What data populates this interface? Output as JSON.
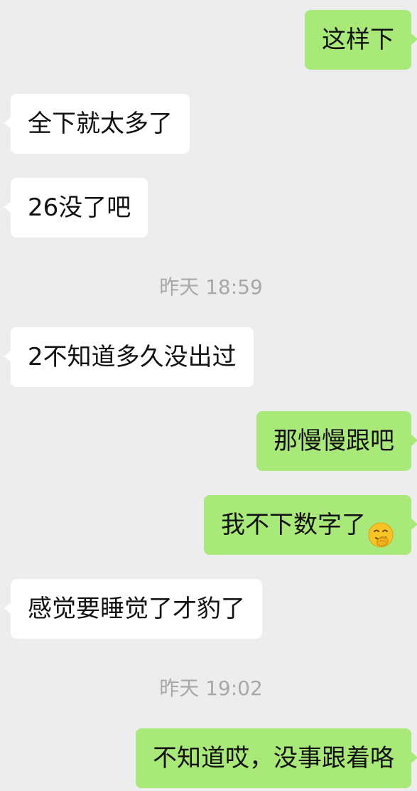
{
  "messages": [
    {
      "side": "out",
      "text": "这样下"
    },
    {
      "side": "in",
      "text": "全下就太多了"
    },
    {
      "side": "in",
      "text": "26没了吧"
    },
    {
      "side": "in",
      "text": "2不知道多久没出过"
    },
    {
      "side": "out",
      "text": "那慢慢跟吧"
    },
    {
      "side": "out",
      "text": "我不下数字了",
      "emoji": "face-with-hand-over-mouth-icon"
    },
    {
      "side": "in",
      "text": "感觉要睡觉了才豹了"
    },
    {
      "side": "out",
      "text": "不知道哎，没事跟着咯"
    }
  ],
  "timestamps": [
    "昨天 18:59",
    "昨天 19:02"
  ],
  "colors": {
    "background": "#ededed",
    "incoming_bubble": "#ffffff",
    "outgoing_bubble": "#a9e97a",
    "timestamp_text": "#a8a8a8"
  }
}
